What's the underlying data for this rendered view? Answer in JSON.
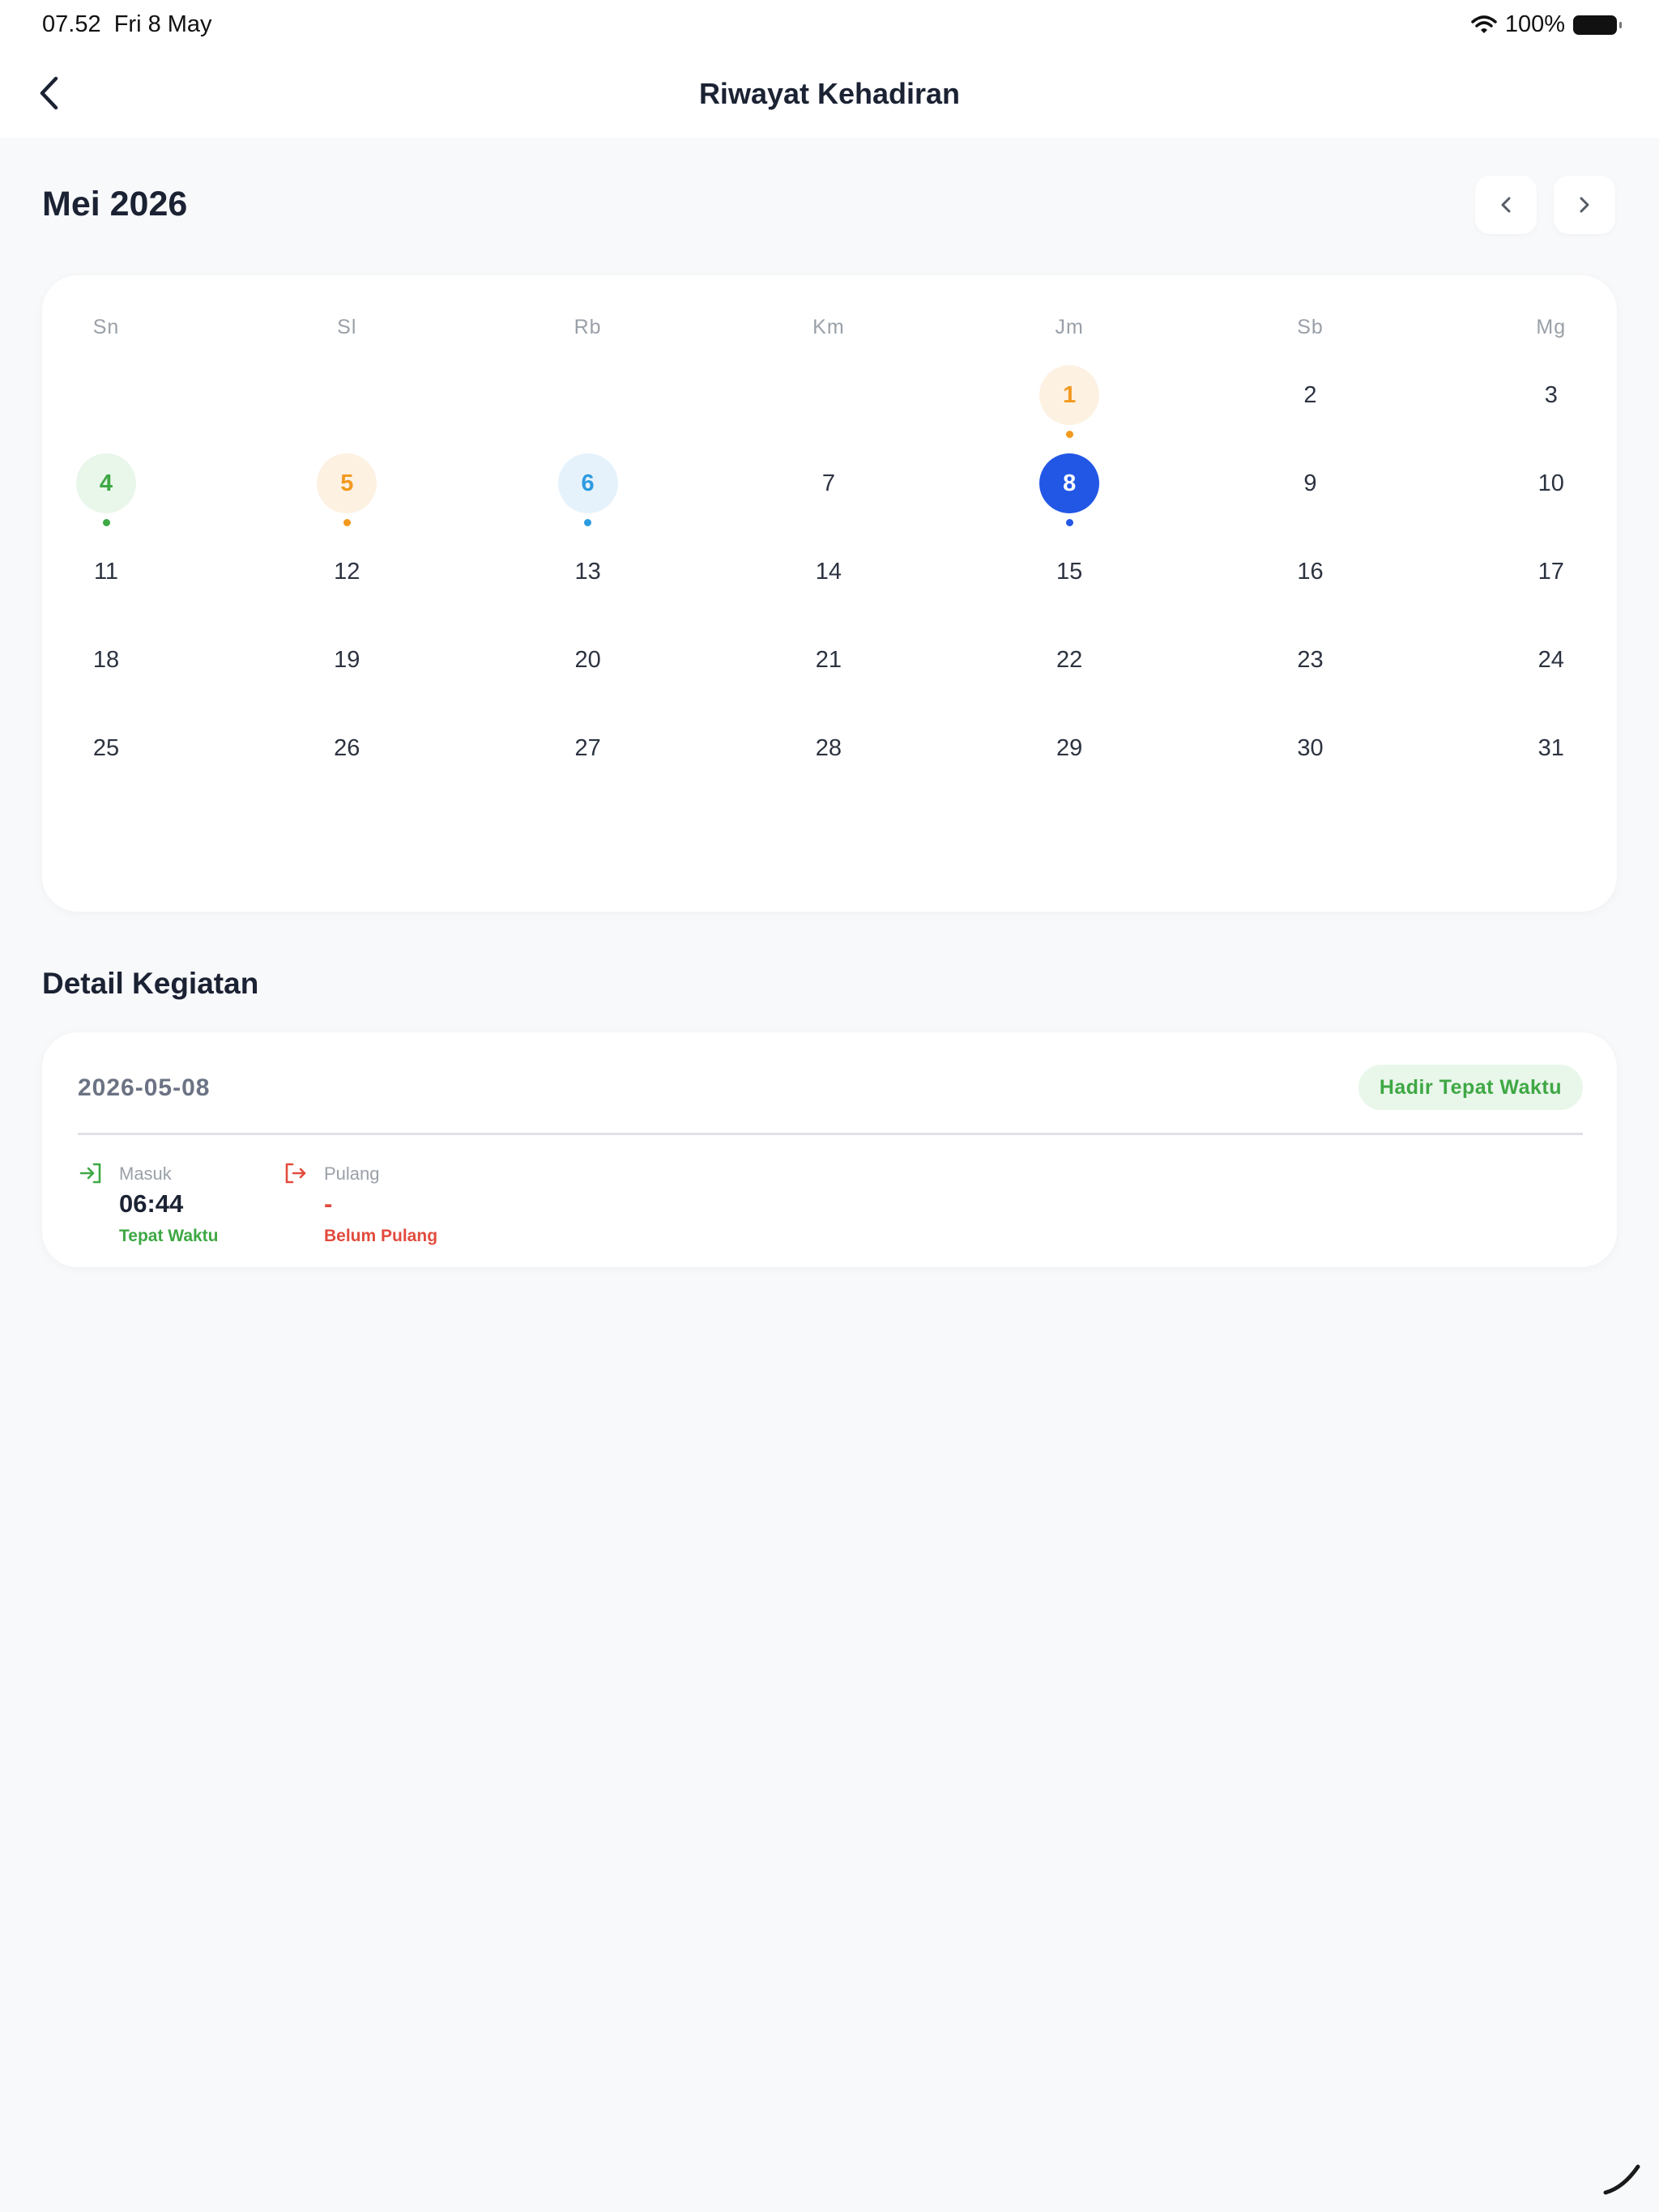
{
  "status_bar": {
    "time": "07.52",
    "date": "Fri 8 May",
    "battery": "100%"
  },
  "header": {
    "title": "Riwayat Kehadiran",
    "back_icon": "chevron-left-icon"
  },
  "calendar": {
    "month_label": "Mei 2026",
    "weekdays": [
      "Sn",
      "Sl",
      "Rb",
      "Km",
      "Jm",
      "Sb",
      "Mg"
    ],
    "first_weekday_index": 4,
    "days_in_month": 31,
    "selected_day": 8,
    "marked_days": [
      {
        "day": 1,
        "status": "late"
      },
      {
        "day": 4,
        "status": "present"
      },
      {
        "day": 5,
        "status": "late"
      },
      {
        "day": 6,
        "status": "info"
      },
      {
        "day": 8,
        "status": "selected"
      }
    ],
    "colors": {
      "late": "#f29a1f",
      "late_bg": "#fdf1e2",
      "present": "#3ea844",
      "present_bg": "#e9f6ea",
      "info": "#2d9be0",
      "info_bg": "#e6f2fb",
      "selected": "#2257e6",
      "selected_dot": "#2257e6"
    }
  },
  "detail": {
    "section_title": "Detail Kegiatan",
    "date": "2026-05-08",
    "status_badge": "Hadir Tepat Waktu",
    "masuk": {
      "label": "Masuk",
      "time": "06:44",
      "note": "Tepat Waktu",
      "icon": "login-icon"
    },
    "pulang": {
      "label": "Pulang",
      "time": "-",
      "note": "Belum Pulang",
      "icon": "logout-icon"
    }
  }
}
